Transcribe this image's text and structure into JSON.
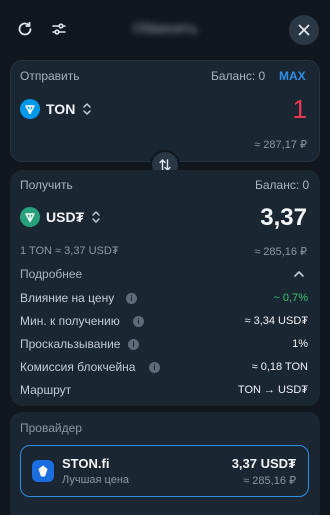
{
  "header": {
    "title": "Обменять",
    "refresh_icon": "refresh-icon",
    "settings_icon": "sliders-icon",
    "close_icon": "close-icon"
  },
  "send": {
    "label": "Отправить",
    "balance": "Баланс: 0",
    "max": "MAX",
    "token": "TON",
    "amount": "1",
    "fiat": "≈ 287,17 ₽"
  },
  "receive": {
    "label": "Получить",
    "balance": "Баланс: 0",
    "token": "USD₮",
    "amount": "3,37",
    "rate": "1 TON ≈ 3,37 USD₮",
    "fiat": "≈ 285,16 ₽"
  },
  "details": {
    "toggle_label": "Подробнее",
    "rows": [
      {
        "label": "Влияние на цену",
        "value": "~ 0,7%"
      },
      {
        "label": "Мин. к получению",
        "value": "≈ 3,34 USD₮"
      },
      {
        "label": "Проскальзывание",
        "value": "1%"
      },
      {
        "label": "Комиссия блокчейна",
        "value": "≈ 0,18 TON"
      },
      {
        "label": "Маршрут",
        "value": "TON → USD₮"
      }
    ]
  },
  "provider": {
    "section_label": "Провайдер",
    "name": "STON.fi",
    "tagline": "Лучшая цена",
    "amount": "3,37 USD₮",
    "fiat": "≈ 285,16 ₽"
  },
  "colors": {
    "background": "#10171e",
    "card": "#1b2633",
    "accent": "#2f8fe6",
    "red": "#ec3a52",
    "green": "#35c56f",
    "ton": "#0098ea",
    "usdt": "#26a17b"
  }
}
